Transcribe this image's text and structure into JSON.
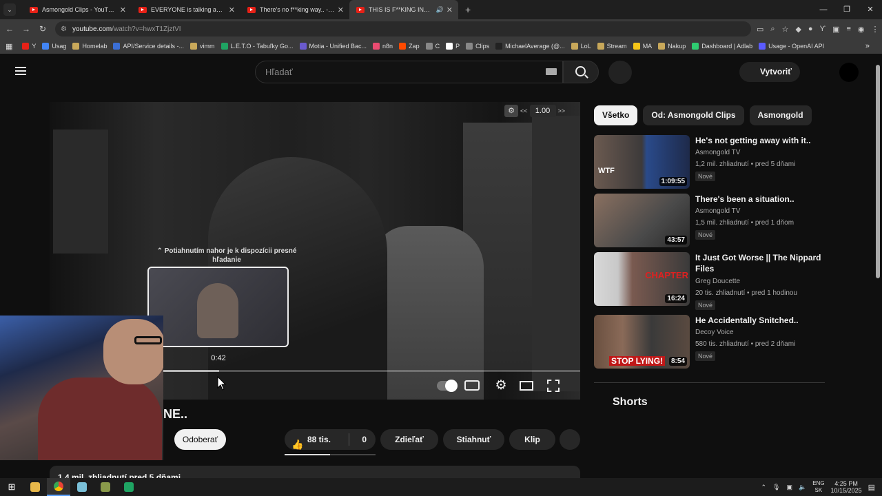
{
  "browser": {
    "tabs": [
      {
        "title": "Asmongold Clips - YouTube"
      },
      {
        "title": "EVERYONE is talking about this"
      },
      {
        "title": "There's no f**king way.. - YouTu"
      },
      {
        "title": "THIS IS F**KING INSANE.. -"
      }
    ],
    "url_host": "youtube.com",
    "url_path": "/watch?v=hwxT1ZjztVI",
    "bookmarks": [
      {
        "label": "Y",
        "color": "#e62117"
      },
      {
        "label": "Usag",
        "color": "#4285f4"
      },
      {
        "label": "Homelab",
        "color": "#c8a85a"
      },
      {
        "label": "API/Service details -...",
        "color": "#3b6fd6"
      },
      {
        "label": "vimm",
        "color": "#c8a85a"
      },
      {
        "label": "L.E.T.O - Tabuľky Go...",
        "color": "#1fa463"
      },
      {
        "label": "Motia - Unified Bac...",
        "color": "#6a5acd"
      },
      {
        "label": "n8n",
        "color": "#ea4b71"
      },
      {
        "label": "Zap",
        "color": "#ff4a00"
      },
      {
        "label": "C",
        "color": "#888888"
      },
      {
        "label": "P",
        "color": "#ffffff"
      },
      {
        "label": "Clips",
        "color": "#888888"
      },
      {
        "label": "MichaelAverage (@...",
        "color": "#222222"
      },
      {
        "label": "LoL",
        "color": "#c8a85a"
      },
      {
        "label": "Stream",
        "color": "#c8a85a"
      },
      {
        "label": "MA",
        "color": "#f5c518"
      },
      {
        "label": "Nakup",
        "color": "#c8a85a"
      },
      {
        "label": "Dashboard | Adlab",
        "color": "#2ecc71"
      },
      {
        "label": "Usage - OpenAI API",
        "color": "#5b5bff"
      }
    ]
  },
  "youtube": {
    "search_placeholder": "Hľadať",
    "create_label": "Vytvoriť",
    "player": {
      "speed_value": "1.00",
      "seek_hint": "Potiahnutím nahor je k dispozícii presné hľadanie",
      "preview_time": "0:42",
      "progress_fraction": 0.32
    },
    "title_fragment": "NE..",
    "subscribe_label": "Odoberať",
    "likes": "88 tis.",
    "dislikes": "0",
    "share_label": "Zdieľať",
    "download_label": "Stiahnuť",
    "clip_label": "Klip",
    "description_preview": "1,4 mil. zhliadnutí  pred 5 dňami",
    "chips": [
      "Všetko",
      "Od: Asmongold Clips",
      "Asmongold"
    ],
    "recommendations": [
      {
        "title": "He's not getting away with it..",
        "channel": "Asmongold TV",
        "meta": "1,2 mil. zhliadnutí • pred 5 dňami",
        "badge": "Nové",
        "duration": "1:09:55",
        "overlay": "WTF"
      },
      {
        "title": "There's been a situation..",
        "channel": "Asmongold TV",
        "meta": "1,5 mil. zhliadnutí • pred 1 dňom",
        "badge": "Nové",
        "duration": "43:57",
        "overlay": ""
      },
      {
        "title": "It Just Got Worse || The Nippard Files",
        "channel": "Greg Doucette",
        "meta": "20 tis. zhliadnutí • pred 1 hodinou",
        "badge": "Nové",
        "duration": "16:24",
        "overlay": "CHAPTER"
      },
      {
        "title": "He Accidentally Snitched..",
        "channel": "Decoy Voice",
        "meta": "580 tis. zhliadnutí • pred 2 dňami",
        "badge": "Nové",
        "duration": "8:54",
        "overlay": "STOP LYING!"
      }
    ],
    "shorts_label": "Shorts"
  },
  "taskbar": {
    "lang_top": "ENG",
    "lang_bottom": "SK",
    "time": "4:25 PM",
    "date": "10/15/2025"
  }
}
